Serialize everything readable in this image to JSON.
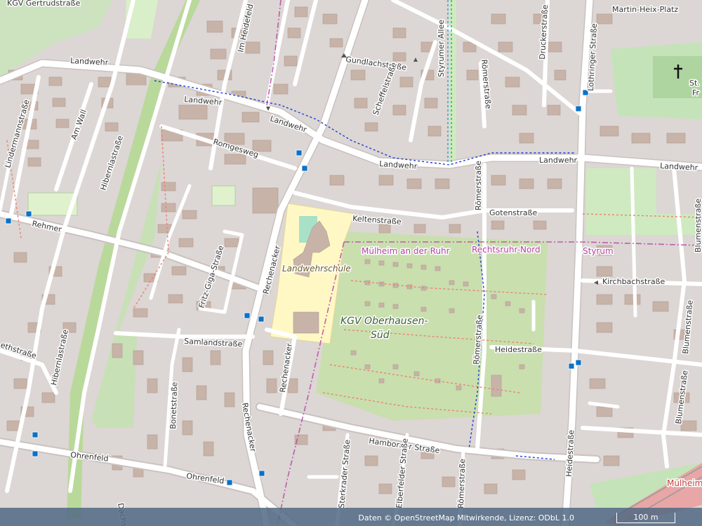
{
  "streets": {
    "landwehr": "Landwehr",
    "gundlachstrasse": "Gundlachstraße",
    "scheffelstrasse": "Scheffelstraße",
    "styrumer_allee": "Styrumer Allee",
    "roemerstrasse": "Römerstraße",
    "druckerstrasse": "Druckerstraße",
    "lothringer_strasse": "Lothringer Straße",
    "martin_heix_platz": "Martin-Heix-Platz",
    "im_heidefeld": "Im Heidefeld",
    "romgesweg": "Romgesweg",
    "lindermannstrasse": "Lindermannstraße",
    "am_wall": "Am Wall",
    "hibernlastrasse": "Hibernlastraße",
    "rehmer": "Rehmer",
    "fritz_giga_strasse": "Fritz-Giga-Straße",
    "keltenstrasse": "Keltenstraße",
    "gotenstrasse": "Gotenstraße",
    "kirchbachstrasse": "Kirchbachstraße",
    "blumenstrasse": "Blumenstraße",
    "rechenacker": "Rechenacker",
    "samlandstrasse": "Samlandstraße",
    "bonetstrasse": "Bonetstraße",
    "heidestrasse": "Heidestraße",
    "hamborner_strasse": "Hamborner Straße",
    "ohrenfeld": "Ohrenfeld",
    "sterkrader_strasse": "Sterkrader Straße",
    "elberfelder_strasse": "Elberfelder Straße",
    "gertrudstrasse": "KGV Gertrudstraße",
    "bethstrasse": "ethstraße",
    "dachs": "Dachs"
  },
  "pois": {
    "school": "Landwehrschule",
    "garden_line1": "KGV Oberhausen-",
    "garden_line2": "Süd",
    "church_partial": "St.",
    "church_partial2": "Fr"
  },
  "boundaries": {
    "muelheim": "Mülheim an der Ruhr",
    "rechtsruhr_nord": "Rechtsruhr-Nord",
    "styrum": "Styrum",
    "muelheim_partial": "Mülheim"
  },
  "attribution": "Daten © OpenStreetMap Mitwirkende, Lizenz: ODbL 1.0",
  "scale_label": "100 m",
  "colors": {
    "background": "#dcd6d4",
    "road": "#ffffff",
    "road_casing": "#c9c2bf",
    "building": "#c8b3a8",
    "building_stroke": "#ae9b91",
    "park": "#c8e0b5",
    "allotment": "#c9dfae",
    "school": "#fff8c4",
    "boundary": "#b43fa3",
    "railway": "#e8a6a6",
    "bus_stop": "#0a72c8"
  }
}
